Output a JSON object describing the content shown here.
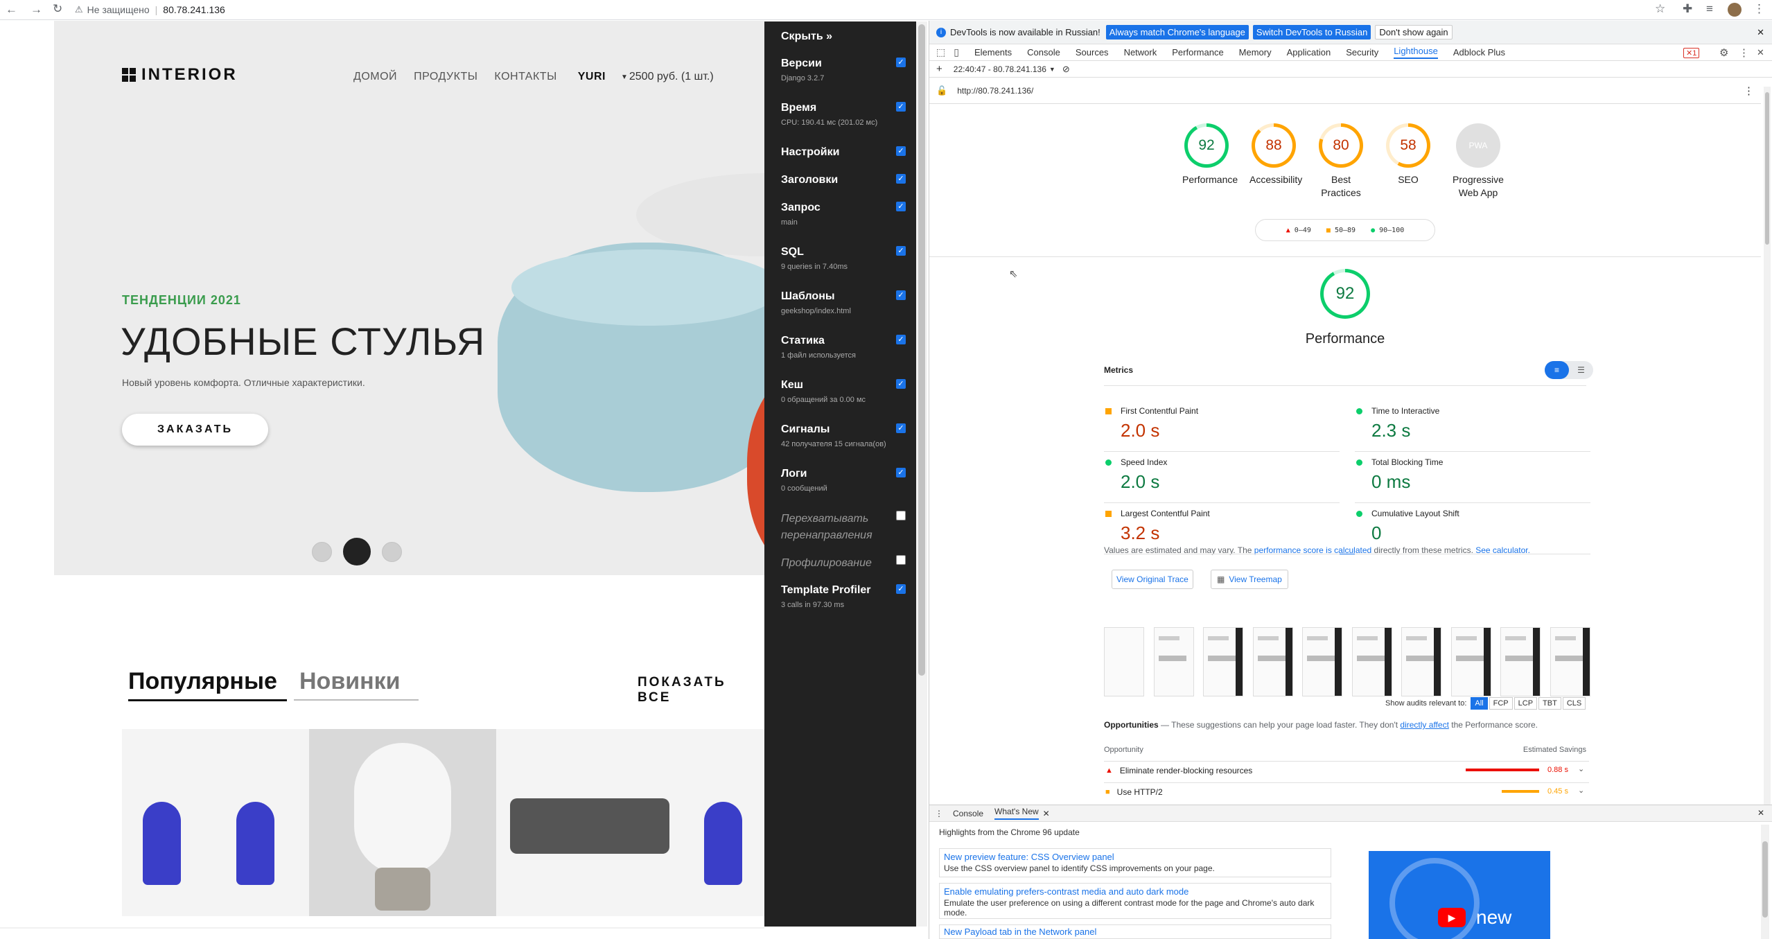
{
  "browser": {
    "security_label": "Не защищено",
    "url": "80.78.241.136"
  },
  "site": {
    "logo": "INTERIOR",
    "nav": [
      "ДОМОЙ",
      "ПРОДУКТЫ",
      "КОНТАКТЫ",
      "YURI"
    ],
    "cart": "2500 руб. (1 шт.)",
    "hero": {
      "kicker": "ТЕНДЕНЦИИ 2021",
      "title": "УДОБНЫЕ СТУЛЬЯ",
      "subtitle": "Новый уровень комфорта. Отличные характеристики.",
      "cta": "ЗАКАЗАТЬ"
    },
    "tabs": {
      "popular": "Популярные",
      "new": "Новинки",
      "show_all": "ПОКАЗАТЬ ВСЕ"
    }
  },
  "djdt": {
    "hide": "Скрыть »",
    "panels": [
      {
        "title": "Версии",
        "sub": "Django 3.2.7",
        "on": true
      },
      {
        "title": "Время",
        "sub": "CPU: 190.41 мс (201.02 мс)",
        "on": true
      },
      {
        "title": "Настройки",
        "sub": "",
        "on": true
      },
      {
        "title": "Заголовки",
        "sub": "",
        "on": true
      },
      {
        "title": "Запрос",
        "sub": "main",
        "on": true
      },
      {
        "title": "SQL",
        "sub": "9 queries in 7.40ms",
        "on": true
      },
      {
        "title": "Шаблоны",
        "sub": "geekshop/index.html",
        "on": true
      },
      {
        "title": "Статика",
        "sub": "1 файл используется",
        "on": true
      },
      {
        "title": "Кеш",
        "sub": "0 обращений за 0.00 мс",
        "on": true
      },
      {
        "title": "Сигналы",
        "sub": "42 получателя 15 сигнала(ов)",
        "on": true
      },
      {
        "title": "Логи",
        "sub": "0 сообщений",
        "on": true
      },
      {
        "title": "Перехватывать перенаправления",
        "sub": "",
        "on": false
      },
      {
        "title": "Профилирование",
        "sub": "",
        "on": false
      },
      {
        "title": "Template Profiler",
        "sub": "3 calls in 97.30 ms",
        "on": true
      }
    ]
  },
  "devtools": {
    "infobar": {
      "text": "DevTools is now available in Russian!",
      "btn1": "Always match Chrome's language",
      "btn2": "Switch DevTools to Russian",
      "btn3": "Don't show again"
    },
    "tabs": [
      "Elements",
      "Console",
      "Sources",
      "Network",
      "Performance",
      "Memory",
      "Application",
      "Security",
      "Lighthouse",
      "Adblock Plus"
    ],
    "active_tab": "Lighthouse",
    "error_count": "1",
    "report_select": "22:40:47 - 80.78.241.136",
    "report_url": "http://80.78.241.136/",
    "scores": [
      {
        "label": "Performance",
        "value": 92,
        "color": "#0cce6b"
      },
      {
        "label": "Accessibility",
        "value": 88,
        "color": "#ffa400"
      },
      {
        "label": "Best Practices",
        "value": 80,
        "color": "#ffa400"
      },
      {
        "label": "SEO",
        "value": 58,
        "color": "#ffa400"
      },
      {
        "label": "Progressive Web App",
        "value": "PWA",
        "color": "#9e9e9e"
      }
    ],
    "legend": [
      "0–49",
      "50–89",
      "90–100"
    ],
    "perf_title": "Performance",
    "metrics_label": "Metrics",
    "metrics": [
      {
        "name": "First Contentful Paint",
        "value": "2.0 s",
        "color": "#c33300",
        "icon": "square"
      },
      {
        "name": "Time to Interactive",
        "value": "2.3 s",
        "color": "#0d7a41",
        "icon": "circle"
      },
      {
        "name": "Speed Index",
        "value": "2.0 s",
        "color": "#0d7a41",
        "icon": "circle"
      },
      {
        "name": "Total Blocking Time",
        "value": "0 ms",
        "color": "#0d7a41",
        "icon": "circle"
      },
      {
        "name": "Largest Contentful Paint",
        "value": "3.2 s",
        "color": "#c33300",
        "icon": "square"
      },
      {
        "name": "Cumulative Layout Shift",
        "value": "0",
        "color": "#0d7a41",
        "icon": "circle"
      }
    ],
    "note1": "Values are estimated and may vary. The ",
    "note_link1": "performance score is calculated",
    "note2": " directly from these metrics. ",
    "note_link2": "See calculator.",
    "btn_trace": "View Original Trace",
    "btn_treemap": "View Treemap",
    "audits_label": "Show audits relevant to:",
    "audit_filters": [
      "All",
      "FCP",
      "LCP",
      "TBT",
      "CLS"
    ],
    "opp_title": "Opportunities",
    "opp_desc": " — These suggestions can help your page load faster. They don't ",
    "opp_link": "directly affect",
    "opp_desc2": " the Performance score.",
    "opp_col1": "Opportunity",
    "opp_col2": "Estimated Savings",
    "opportunities": [
      {
        "name": "Eliminate render-blocking resources",
        "saving": "0.88 s",
        "color": "#eb0f00",
        "fraction": 1.0
      },
      {
        "name": "Use HTTP/2",
        "saving": "0.45 s",
        "color": "#ffa400",
        "fraction": 0.51
      }
    ],
    "drawer": {
      "tabs": [
        "Console",
        "What's New"
      ],
      "highlights": "Highlights from the Chrome 96 update",
      "items": [
        {
          "title": "New preview feature: CSS Overview panel",
          "desc": "Use the CSS overview panel to identify CSS improvements on your page."
        },
        {
          "title": "Enable emulating prefers-contrast media and auto dark mode",
          "desc": "Emulate the user preference on using a different contrast mode for the page and Chrome's auto dark mode."
        },
        {
          "title": "New Payload tab in the Network panel",
          "desc": ""
        }
      ],
      "video_word": "new"
    }
  }
}
